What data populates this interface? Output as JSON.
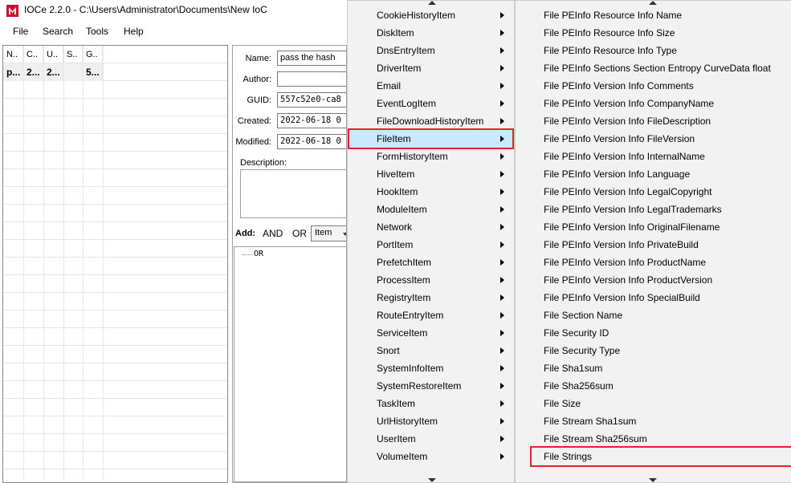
{
  "window": {
    "title": "IOCe 2.2.0 - C:\\Users\\Administrator\\Documents\\New IoC",
    "logo_color": "#c8102e"
  },
  "menubar": {
    "items": [
      "File",
      "Search",
      "Tools",
      "Help"
    ]
  },
  "ioc_list": {
    "columns": [
      "N..",
      "C..",
      "U..",
      "S..",
      "G.."
    ],
    "rows": [
      [
        "p...",
        "2...",
        "2...",
        "",
        "5..."
      ]
    ]
  },
  "details": {
    "name_label": "Name:",
    "name_value": "pass the hash",
    "author_label": "Author:",
    "author_value": "",
    "guid_label": "GUID:",
    "guid_value": "557c52e0-ca8",
    "created_label": "Created:",
    "created_value": "2022-06-18 0",
    "modified_label": "Modified:",
    "modified_value": "2022-06-18 0",
    "description_label": "Description:",
    "description_value": ""
  },
  "add_bar": {
    "label": "Add:",
    "and_label": "AND",
    "or_label": "OR",
    "item_select": "Item"
  },
  "tree": {
    "root": "OR"
  },
  "item_menu": {
    "items": [
      "CookieHistoryItem",
      "DiskItem",
      "DnsEntryItem",
      "DriverItem",
      "Email",
      "EventLogItem",
      "FileDownloadHistoryItem",
      "FileItem",
      "FormHistoryItem",
      "HiveItem",
      "HookItem",
      "ModuleItem",
      "Network",
      "PortItem",
      "PrefetchItem",
      "ProcessItem",
      "RegistryItem",
      "RouteEntryItem",
      "ServiceItem",
      "Snort",
      "SystemInfoItem",
      "SystemRestoreItem",
      "TaskItem",
      "UrlHistoryItem",
      "UserItem",
      "VolumeItem"
    ],
    "selected": "FileItem",
    "selected_color": "#cce8ff",
    "highlight_color": "#e0242b"
  },
  "fileitem_submenu": {
    "items": [
      "File PEInfo Resource Info Name",
      "File PEInfo Resource Info Size",
      "File PEInfo Resource Info Type",
      "File PEInfo Sections Section Entropy CurveData float",
      "File PEInfo Version Info Comments",
      "File PEInfo Version Info CompanyName",
      "File PEInfo Version Info FileDescription",
      "File PEInfo Version Info FileVersion",
      "File PEInfo Version Info InternalName",
      "File PEInfo Version Info Language",
      "File PEInfo Version Info LegalCopyright",
      "File PEInfo Version Info LegalTrademarks",
      "File PEInfo Version Info OriginalFilename",
      "File PEInfo Version Info PrivateBuild",
      "File PEInfo Version Info ProductName",
      "File PEInfo Version Info ProductVersion",
      "File PEInfo Version Info SpecialBuild",
      "File Section Name",
      "File Security ID",
      "File Security Type",
      "File Sha1sum",
      "File Sha256sum",
      "File Size",
      "File Stream Sha1sum",
      "File Stream Sha256sum",
      "File Strings"
    ],
    "highlighted": "File Strings"
  }
}
